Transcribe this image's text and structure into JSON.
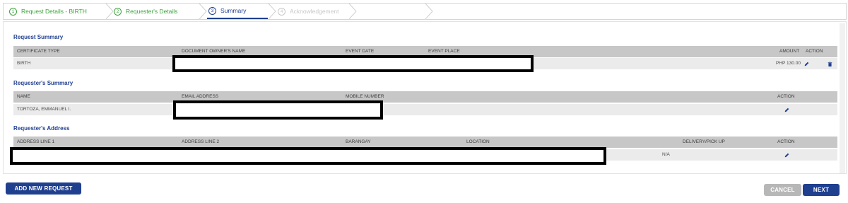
{
  "stepper": {
    "steps": [
      {
        "num": "1",
        "label": "Request Details - BIRTH",
        "state": "done"
      },
      {
        "num": "2",
        "label": "Requester's Details",
        "state": "done"
      },
      {
        "num": "3",
        "label": "Summary",
        "state": "active"
      },
      {
        "num": "4",
        "label": "Acknowledgement",
        "state": "future"
      }
    ]
  },
  "request_summary": {
    "title": "Request Summary",
    "headers": {
      "certificate_type": "CERTIFICATE TYPE",
      "owner_name": "DOCUMENT OWNER'S NAME",
      "event_date": "EVENT DATE",
      "event_place": "EVENT PLACE",
      "amount": "AMOUNT",
      "action": "ACTION"
    },
    "row": {
      "certificate_type": "BIRTH",
      "amount": "PHP 130.00"
    }
  },
  "requester_summary": {
    "title": "Requester's Summary",
    "headers": {
      "name": "NAME",
      "email": "EMAIL ADDRESS",
      "mobile": "MOBILE NUMBER",
      "action": "ACTION"
    },
    "row": {
      "name": "TORTOZA, EMMANUEL I."
    }
  },
  "requester_address": {
    "title": "Requester's Address",
    "headers": {
      "line1": "ADDRESS LINE 1",
      "line2": "ADDRESS LINE 2",
      "barangay": "BARANGAY",
      "location": "LOCATION",
      "delivery": "DELIVERY/PICK UP",
      "action": "ACTION"
    },
    "row": {
      "delivery": "N/A"
    }
  },
  "footer": {
    "add_new_request": "ADD NEW REQUEST",
    "cancel": "CANCEL",
    "next": "NEXT"
  },
  "colors": {
    "primary": "#1f3f8f",
    "done": "#3aa43a",
    "header_bg": "#c7c7c7",
    "row_bg": "#ebebeb",
    "disabled": "#b7b7b7"
  },
  "icons": [
    "pencil-icon",
    "trash-icon",
    "chevron-right-icon"
  ]
}
